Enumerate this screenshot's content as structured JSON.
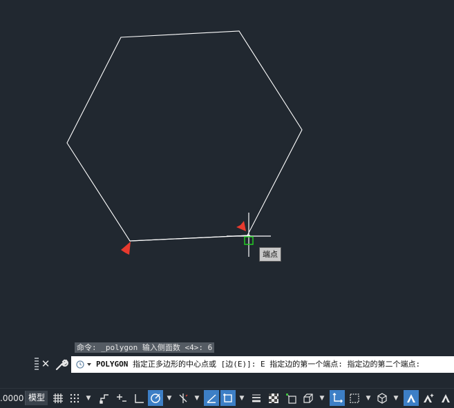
{
  "viewport": {
    "background": "#212830",
    "geometry_color": "#ffffff",
    "crosshair_color": "#ffffff",
    "snap_marker_color": "#22cc22",
    "annotation_arrow_color": "#e83a2e"
  },
  "snap_tooltip": "端点",
  "command_history": "命令: _polygon 输入侧面数 <4>: 6",
  "command_line": {
    "command": "POLYGON",
    "prompt": " 指定正多边形的中心点或 [边(E)]: E 指定边的第一个端点: 指定边的第二个端点:"
  },
  "status_bar": {
    "coordinate_fragment": ".0000",
    "model_tab": "模型",
    "icons": [
      "grid-icon",
      "snap-grid-icon",
      "ortho-icon",
      "polar-tracking-icon",
      "isometric-icon",
      "object-snap-tracking-icon",
      "object-snap-icon",
      "dynamic-input-icon",
      "lineweight-icon",
      "transparency-icon",
      "selection-cycling-icon",
      "3d-object-snap-icon",
      "dynamic-ucs-icon",
      "selection-filter-icon",
      "gizmo-icon",
      "annotation-visibility-icon",
      "auto-scale-icon",
      "annotation-scale-icon"
    ]
  }
}
